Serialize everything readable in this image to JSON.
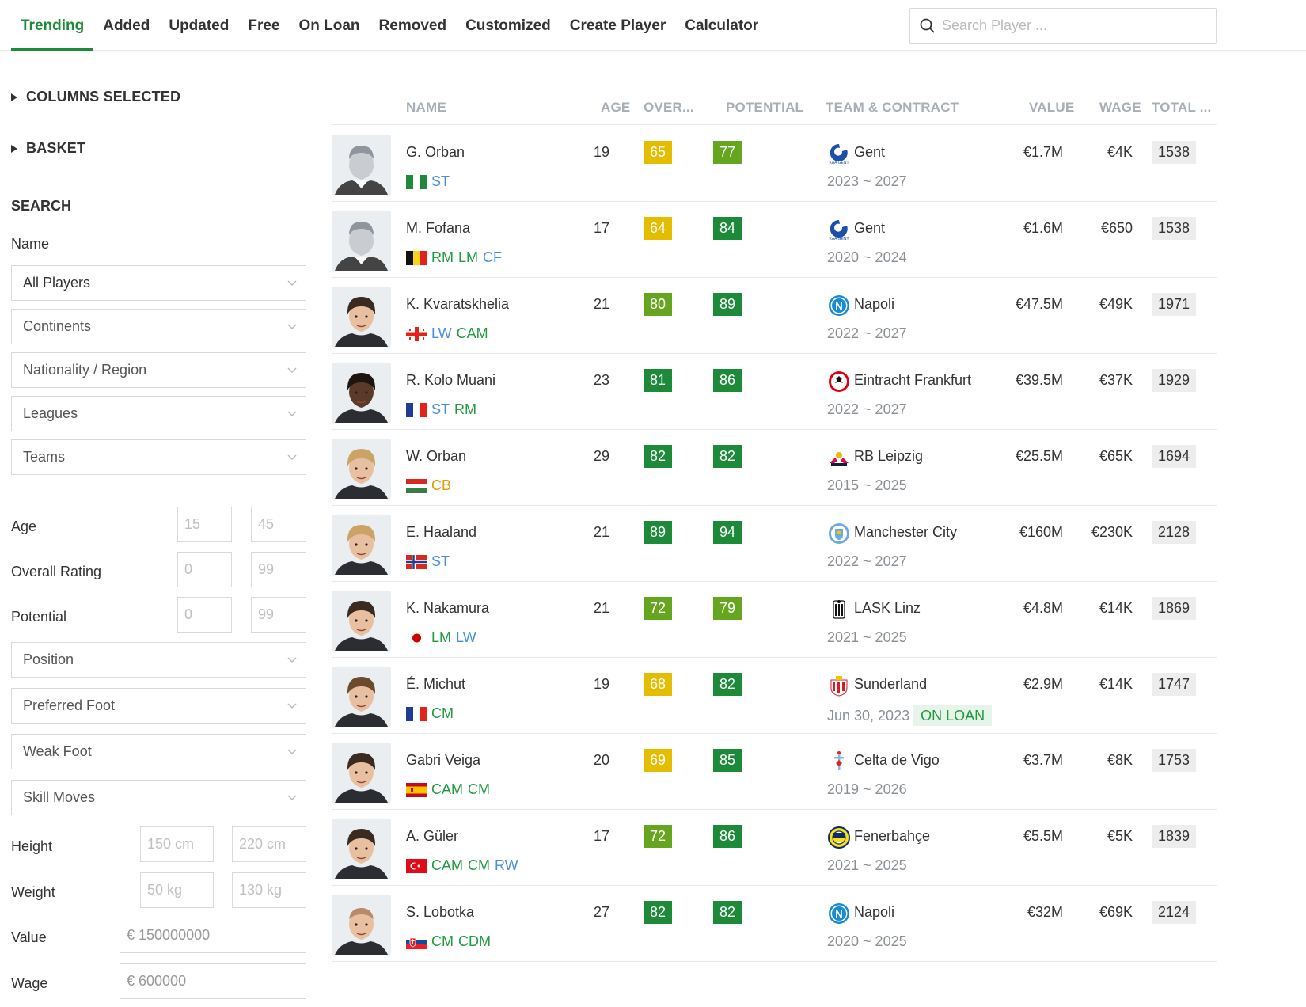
{
  "nav": {
    "tabs": [
      "Trending",
      "Added",
      "Updated",
      "Free",
      "On Loan",
      "Removed",
      "Customized",
      "Create Player",
      "Calculator"
    ],
    "active_tab": "Trending",
    "search_placeholder": "Search Player ..."
  },
  "sidebar": {
    "columns_selected": "COLUMNS SELECTED",
    "basket": "BASKET",
    "search_heading": "SEARCH",
    "name_label": "Name",
    "all_players": "All Players",
    "continents": "Continents",
    "nationality": "Nationality / Region",
    "leagues": "Leagues",
    "teams": "Teams",
    "age_label": "Age",
    "age_min": "15",
    "age_max": "45",
    "overall_label": "Overall Rating",
    "overall_min": "0",
    "overall_max": "99",
    "potential_label": "Potential",
    "potential_min": "0",
    "potential_max": "99",
    "position": "Position",
    "preferred_foot": "Preferred Foot",
    "weak_foot": "Weak Foot",
    "skill_moves": "Skill Moves",
    "height_label": "Height",
    "height_min": "150 cm",
    "height_max": "220 cm",
    "weight_label": "Weight",
    "weight_min": "50 kg",
    "weight_max": "130 kg",
    "value_label": "Value",
    "value_placeholder": "€ 150000000",
    "wage_label": "Wage",
    "wage_placeholder": "€ 600000"
  },
  "table": {
    "headers": {
      "name": "NAME",
      "age": "AGE",
      "overall": "OVER...",
      "potential": "POTENTIAL",
      "team": "TEAM & CONTRACT",
      "value": "VALUE",
      "wage": "WAGE",
      "total": "TOTAL ..."
    },
    "rows": [
      {
        "name": "G. Orban",
        "flag": "nigeria",
        "positions": [
          {
            "p": "ST",
            "c": "att"
          }
        ],
        "age": "19",
        "overall": "65",
        "overall_color": "yellow",
        "potential": "77",
        "potential_color": "lgreen",
        "team": "Gent",
        "logo": "gent",
        "contract": "2023 ~ 2027",
        "on_loan": "",
        "value": "€1.7M",
        "wage": "€4K",
        "total": "1538",
        "avatar": "placeholder"
      },
      {
        "name": "M. Fofana",
        "flag": "belgium",
        "positions": [
          {
            "p": "RM",
            "c": "mid"
          },
          {
            "p": "LM",
            "c": "mid"
          },
          {
            "p": "CF",
            "c": "att"
          }
        ],
        "age": "17",
        "overall": "64",
        "overall_color": "yellow",
        "potential": "84",
        "potential_color": "green",
        "team": "Gent",
        "logo": "gent",
        "contract": "2020 ~ 2024",
        "on_loan": "",
        "value": "€1.6M",
        "wage": "€650",
        "total": "1538",
        "avatar": "placeholder"
      },
      {
        "name": "K. Kvaratskhelia",
        "flag": "georgia",
        "positions": [
          {
            "p": "LW",
            "c": "att"
          },
          {
            "p": "CAM",
            "c": "mid"
          }
        ],
        "age": "21",
        "overall": "80",
        "overall_color": "lgreen",
        "potential": "89",
        "potential_color": "green",
        "team": "Napoli",
        "logo": "napoli",
        "contract": "2022 ~ 2027",
        "on_loan": "",
        "value": "€47.5M",
        "wage": "€49K",
        "total": "1971",
        "avatar": "dark-hair"
      },
      {
        "name": "R. Kolo Muani",
        "flag": "france",
        "positions": [
          {
            "p": "ST",
            "c": "att"
          },
          {
            "p": "RM",
            "c": "mid"
          }
        ],
        "age": "23",
        "overall": "81",
        "overall_color": "green",
        "potential": "86",
        "potential_color": "green",
        "team": "Eintracht Frankfurt",
        "logo": "frankfurt",
        "contract": "2022 ~ 2027",
        "on_loan": "",
        "value": "€39.5M",
        "wage": "€37K",
        "total": "1929",
        "avatar": "dark-skin"
      },
      {
        "name": "W. Orban",
        "flag": "hungary",
        "positions": [
          {
            "p": "CB",
            "c": "def"
          }
        ],
        "age": "29",
        "overall": "82",
        "overall_color": "green",
        "potential": "82",
        "potential_color": "green",
        "team": "RB Leipzig",
        "logo": "leipzig",
        "contract": "2015 ~ 2025",
        "on_loan": "",
        "value": "€25.5M",
        "wage": "€65K",
        "total": "1694",
        "avatar": "light-hair"
      },
      {
        "name": "E. Haaland",
        "flag": "norway",
        "positions": [
          {
            "p": "ST",
            "c": "att"
          }
        ],
        "age": "21",
        "overall": "89",
        "overall_color": "green",
        "potential": "94",
        "potential_color": "green",
        "team": "Manchester City",
        "logo": "mancity",
        "contract": "2022 ~ 2027",
        "on_loan": "",
        "value": "€160M",
        "wage": "€230K",
        "total": "2128",
        "avatar": "blond"
      },
      {
        "name": "K. Nakamura",
        "flag": "japan",
        "positions": [
          {
            "p": "LM",
            "c": "mid"
          },
          {
            "p": "LW",
            "c": "att"
          }
        ],
        "age": "21",
        "overall": "72",
        "overall_color": "lgreen",
        "potential": "79",
        "potential_color": "lgreen",
        "team": "LASK Linz",
        "logo": "lask",
        "contract": "2021 ~ 2025",
        "on_loan": "",
        "value": "€4.8M",
        "wage": "€14K",
        "total": "1869",
        "avatar": "dark-hair"
      },
      {
        "name": "É. Michut",
        "flag": "france",
        "positions": [
          {
            "p": "CM",
            "c": "mid"
          }
        ],
        "age": "19",
        "overall": "68",
        "overall_color": "yellow",
        "potential": "82",
        "potential_color": "green",
        "team": "Sunderland",
        "logo": "sunderland",
        "contract": "Jun 30, 2023",
        "on_loan": "ON LOAN",
        "value": "€2.9M",
        "wage": "€14K",
        "total": "1747",
        "avatar": "brown-hair"
      },
      {
        "name": "Gabri Veiga",
        "flag": "spain",
        "positions": [
          {
            "p": "CAM",
            "c": "mid"
          },
          {
            "p": "CM",
            "c": "mid"
          }
        ],
        "age": "20",
        "overall": "69",
        "overall_color": "yellow",
        "potential": "85",
        "potential_color": "green",
        "team": "Celta de Vigo",
        "logo": "celta",
        "contract": "2019 ~ 2026",
        "on_loan": "",
        "value": "€3.7M",
        "wage": "€8K",
        "total": "1753",
        "avatar": "dark-hair"
      },
      {
        "name": "A. Güler",
        "flag": "turkey",
        "positions": [
          {
            "p": "CAM",
            "c": "mid"
          },
          {
            "p": "CM",
            "c": "mid"
          },
          {
            "p": "RW",
            "c": "att"
          }
        ],
        "age": "17",
        "overall": "72",
        "overall_color": "lgreen",
        "potential": "86",
        "potential_color": "green",
        "team": "Fenerbahçe",
        "logo": "fenerbahce",
        "contract": "2021 ~ 2025",
        "on_loan": "",
        "value": "€5.5M",
        "wage": "€5K",
        "total": "1839",
        "avatar": "dark-hair"
      },
      {
        "name": "S. Lobotka",
        "flag": "slovakia",
        "positions": [
          {
            "p": "CM",
            "c": "mid"
          },
          {
            "p": "CDM",
            "c": "mid"
          }
        ],
        "age": "27",
        "overall": "82",
        "overall_color": "green",
        "potential": "82",
        "potential_color": "green",
        "team": "Napoli",
        "logo": "napoli",
        "contract": "2020 ~ 2025",
        "on_loan": "",
        "value": "€32M",
        "wage": "€69K",
        "total": "2124",
        "avatar": "bald"
      }
    ]
  },
  "colors": {
    "accent": "#1f8a3b",
    "rating_yellow": "#e5bd00",
    "rating_light_green": "#66a61e",
    "rating_green": "#1d8a3a"
  }
}
